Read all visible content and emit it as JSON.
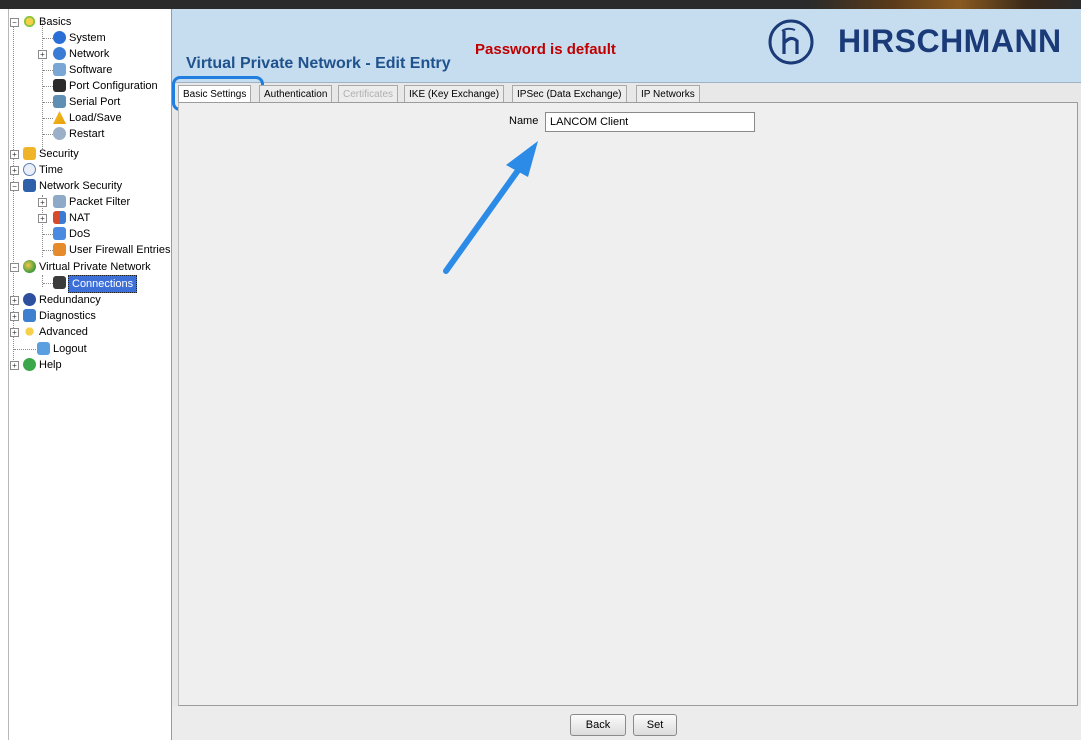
{
  "header": {
    "title": "Virtual Private Network - Edit Entry",
    "warning": "Password is default",
    "brand": "HIRSCHMANN",
    "colors": {
      "header_bg": "#c6dcef",
      "title": "#20538d",
      "warning": "#c00000",
      "brand": "#1a3a78",
      "highlight": "#1f7ee0"
    }
  },
  "tree": [
    {
      "label": "Basics",
      "icon": "star-icon",
      "expanded": true
    },
    {
      "label": "System",
      "icon": "info-icon"
    },
    {
      "label": "Network",
      "icon": "network-user-icon"
    },
    {
      "label": "Software",
      "icon": "software-icon"
    },
    {
      "label": "Port Configuration",
      "icon": "port-icon"
    },
    {
      "label": "Serial Port",
      "icon": "serial-port-icon"
    },
    {
      "label": "Load/Save",
      "icon": "warning-icon"
    },
    {
      "label": "Restart",
      "icon": "restart-icon"
    },
    {
      "label": "Security",
      "icon": "lock-icon"
    },
    {
      "label": "Time",
      "icon": "clock-icon"
    },
    {
      "label": "Network Security",
      "icon": "network-security-icon",
      "expanded": true
    },
    {
      "label": "Packet Filter",
      "icon": "filter-icon"
    },
    {
      "label": "NAT",
      "icon": "nat-icon"
    },
    {
      "label": "DoS",
      "icon": "dos-icon"
    },
    {
      "label": "User Firewall Entries",
      "icon": "user-firewall-icon"
    },
    {
      "label": "Virtual Private Network",
      "icon": "globe-icon",
      "expanded": true
    },
    {
      "label": "Connections",
      "icon": "connections-icon",
      "selected": true
    },
    {
      "label": "Redundancy",
      "icon": "redundancy-icon"
    },
    {
      "label": "Diagnostics",
      "icon": "diagnostics-icon"
    },
    {
      "label": "Advanced",
      "icon": "star-icon"
    },
    {
      "label": "Logout",
      "icon": "logout-icon"
    },
    {
      "label": "Help",
      "icon": "help-icon"
    }
  ],
  "tabs": [
    {
      "label": "Basic Settings",
      "active": true
    },
    {
      "label": "Authentication"
    },
    {
      "label": "Certificates",
      "disabled": true
    },
    {
      "label": "IKE (Key Exchange)"
    },
    {
      "label": "IPSec (Data Exchange)"
    },
    {
      "label": "IP Networks"
    }
  ],
  "form": {
    "name_label": "Name",
    "name_value": "LANCOM Client"
  },
  "buttons": {
    "back": "Back",
    "set": "Set"
  }
}
